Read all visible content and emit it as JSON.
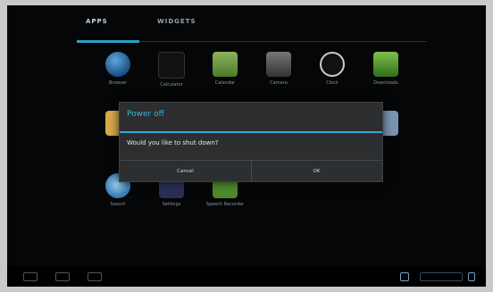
{
  "tabs": {
    "apps": "APPS",
    "widgets": "WIDGETS"
  },
  "apps": [
    {
      "label": "Browser"
    },
    {
      "label": "Calculator"
    },
    {
      "label": "Calendar"
    },
    {
      "label": "Camera"
    },
    {
      "label": "Clock"
    },
    {
      "label": "Downloads"
    },
    {
      "label": "Search"
    },
    {
      "label": "Settings"
    },
    {
      "label": "Speech Recorder"
    }
  ],
  "dialog": {
    "title": "Power off",
    "message": "Would you like to shut down?",
    "cancel": "Cancel",
    "ok": "OK"
  },
  "colors": {
    "accent": "#35b3e0"
  }
}
